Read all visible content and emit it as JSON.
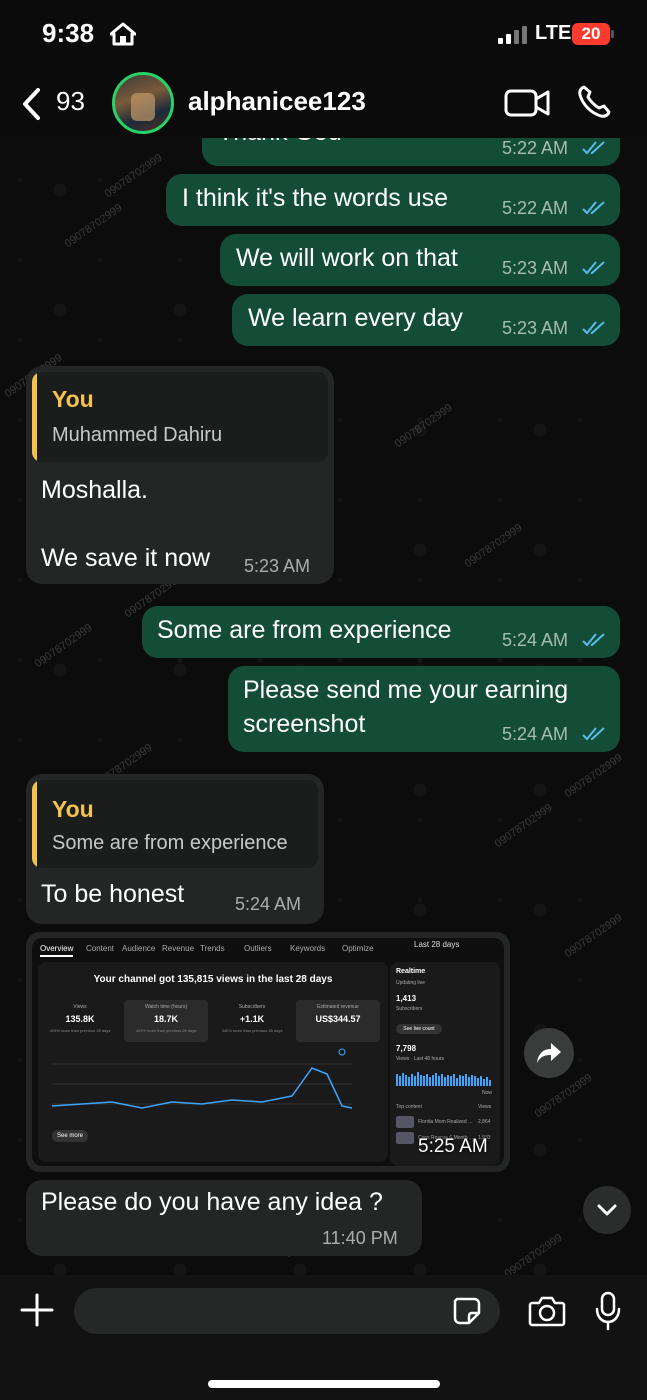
{
  "status_bar": {
    "time": "9:38",
    "network": "LTE",
    "battery": "20"
  },
  "header": {
    "back_count": "93",
    "contact_name": "alphanicee123"
  },
  "messages": [
    {
      "direction": "out",
      "text": "Thank God",
      "time": "5:22 AM",
      "read": true
    },
    {
      "direction": "out",
      "text": "I think it's the words use",
      "time": "5:22 AM",
      "read": true
    },
    {
      "direction": "out",
      "text": "We will work on that",
      "time": "5:23 AM",
      "read": true
    },
    {
      "direction": "out",
      "text": "We learn every day",
      "time": "5:23 AM",
      "read": true
    },
    {
      "direction": "in",
      "quote_author": "You",
      "quote_text": "Muhammed Dahiru",
      "text_line1": "Moshalla.",
      "text_line2": "We save it now",
      "time": "5:23 AM"
    },
    {
      "direction": "out",
      "text": "Some are from experience",
      "time": "5:24 AM",
      "read": true
    },
    {
      "direction": "out",
      "text_line1": "Please send me your earning",
      "text_line2": "screenshot",
      "time": "5:24 AM",
      "read": true
    },
    {
      "direction": "in",
      "quote_author": "You",
      "quote_text": "Some are from experience",
      "text": "To be honest",
      "time": "5:24 AM"
    },
    {
      "direction": "in",
      "type": "image",
      "time": "5:25 AM"
    },
    {
      "direction": "in",
      "text": "Please do you have any idea ?",
      "time": "11:40 PM"
    }
  ],
  "screenshot": {
    "tabs": [
      "Overview",
      "Content",
      "Audience",
      "Revenue",
      "Trends",
      "Outliers",
      "Keywords",
      "Optimize"
    ],
    "range": "Last 28 days",
    "headline": "Your channel got 135,815 views in the last 28 days",
    "stats": [
      {
        "label": "Views",
        "value": "135.8K",
        "note": "403% more than previous 28 days"
      },
      {
        "label": "Watch time (hours)",
        "value": "18.7K",
        "note": "423% more than previous 28 days"
      },
      {
        "label": "Subscribers",
        "value": "+1.1K",
        "note": "340% more than previous 28 days"
      },
      {
        "label": "Estimated revenue",
        "value": "US$344.57",
        "note": ""
      }
    ],
    "see_more": "See more",
    "realtime": {
      "title": "Realtime",
      "updating": "Updating live",
      "subscribers_value": "1,413",
      "subscribers_label": "Subscribers",
      "live_count_button": "See live count",
      "views_value": "7,798",
      "views_label": "Views · Last 48 hours",
      "now_label": "Now",
      "top_content_label": "Top content",
      "views_col": "Views",
      "top_items": [
        {
          "title": "Florida Mom Realized ...",
          "views": "2,864"
        },
        {
          "title": "Cops Rescue 6 Month ...",
          "views": "1,933"
        }
      ]
    }
  },
  "colors": {
    "outgoing_bubble": "#144d37",
    "incoming_bubble": "#242626",
    "quote_accent": "#f5c34d",
    "read_tick": "#53bdeb",
    "online_ring": "#25d366"
  },
  "watermarks": [
    "090787",
    "09078702999",
    "78702999"
  ]
}
